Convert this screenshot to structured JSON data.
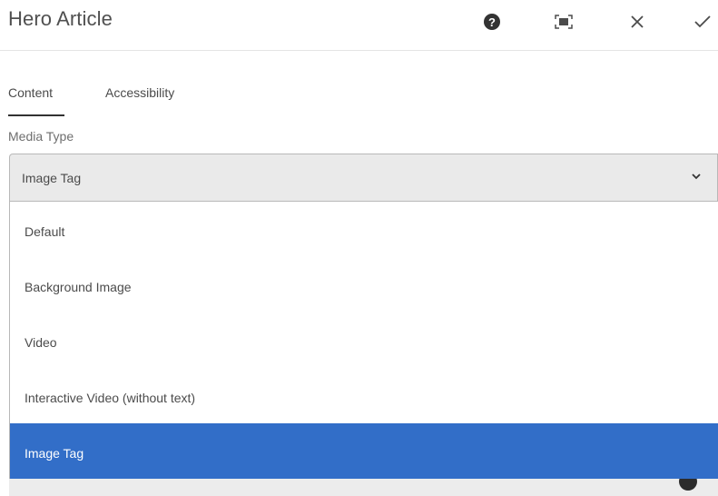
{
  "dialog": {
    "title": "Hero Article",
    "actions": {
      "help_icon": "help-icon",
      "fullscreen_icon": "fullscreen-icon",
      "close_icon": "close-icon",
      "done_icon": "checkmark-icon"
    }
  },
  "tabs": [
    {
      "label": "Content",
      "active": true
    },
    {
      "label": "Accessibility",
      "active": false
    }
  ],
  "media_type": {
    "label": "Media Type",
    "selected": "Image Tag",
    "options": [
      {
        "label": "Default",
        "selected": false
      },
      {
        "label": "Background Image",
        "selected": false
      },
      {
        "label": "Video",
        "selected": false
      },
      {
        "label": "Interactive Video (without text)",
        "selected": false
      },
      {
        "label": "Image Tag",
        "selected": true
      }
    ]
  },
  "colors": {
    "accent": "#326ec8",
    "text": "#4b4b4b",
    "field_bg": "#eaeaea"
  }
}
